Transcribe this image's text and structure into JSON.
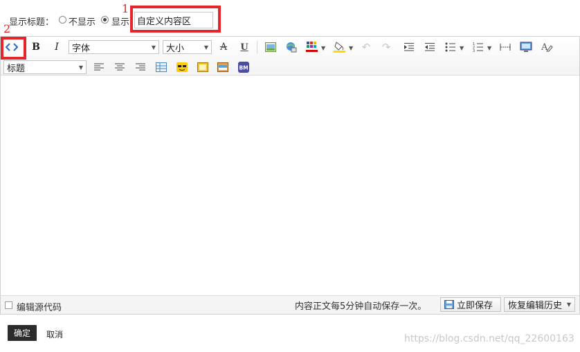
{
  "title_row": {
    "label": "显示标题：",
    "option_hide": "不显示",
    "option_show": "显示",
    "input_value": "自定义内容区"
  },
  "annotations": {
    "one": "1",
    "two": "2"
  },
  "toolbar": {
    "font_select": "字体",
    "size_select": "大小",
    "heading_select": "标题",
    "bold": "B",
    "italic": "I",
    "strike": "A",
    "underline": "U"
  },
  "statusbar": {
    "edit_source": "编辑源代码",
    "autosave_note": "内容正文每5分钟自动保存一次。",
    "save_now": "立即保存",
    "restore_history": "恢复编辑历史"
  },
  "footer": {
    "confirm": "确定",
    "cancel": "取消",
    "watermark": "https://blog.csdn.net/qq_22600163"
  },
  "colors": {
    "highlight_red": "#e5252a",
    "confirm_bg": "#2b2b2b"
  }
}
